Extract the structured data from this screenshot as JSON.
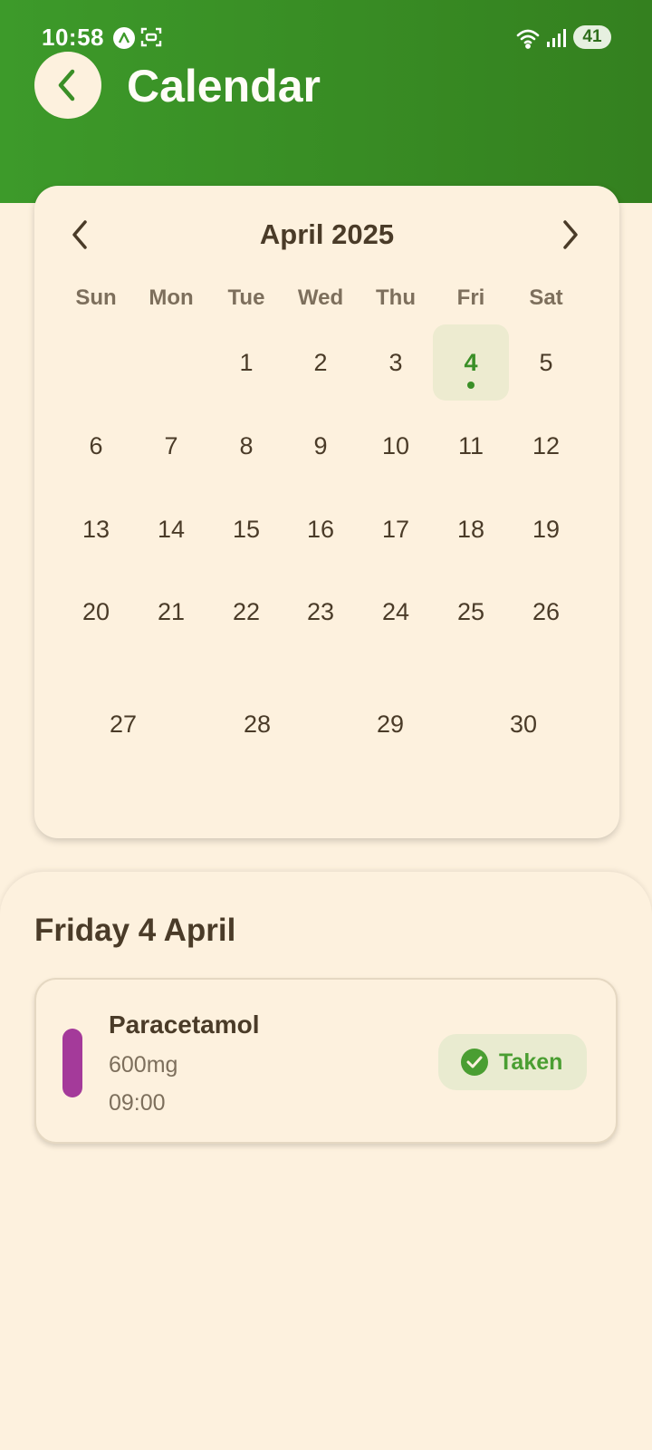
{
  "status_bar": {
    "time": "10:58",
    "battery": "41",
    "icons": [
      "app-a-icon",
      "screen-capture-icon",
      "wifi-icon",
      "signal-icon"
    ]
  },
  "header": {
    "title": "Calendar",
    "back_icon": "chevron-left-icon",
    "background_color": "#3d9a2a"
  },
  "calendar": {
    "month_title": "April 2025",
    "weekdays": [
      "Sun",
      "Mon",
      "Tue",
      "Wed",
      "Thu",
      "Fri",
      "Sat"
    ],
    "days": {
      "d1": "1",
      "d2": "2",
      "d3": "3",
      "d4": "4",
      "d5": "5",
      "d6": "6",
      "d7": "7",
      "d8": "8",
      "d9": "9",
      "d10": "10",
      "d11": "11",
      "d12": "12",
      "d13": "13",
      "d14": "14",
      "d15": "15",
      "d16": "16",
      "d17": "17",
      "d18": "18",
      "d19": "19",
      "d20": "20",
      "d21": "21",
      "d22": "22",
      "d23": "23",
      "d24": "24",
      "d25": "25",
      "d26": "26",
      "d27": "27",
      "d28": "28",
      "d29": "29",
      "d30": "30"
    },
    "selected_day": "4",
    "accent_color": "#3a8f27"
  },
  "day_detail": {
    "heading": "Friday 4 April",
    "medications": [
      {
        "name": "Paracetamol",
        "dose": "600mg",
        "time": "09:00",
        "status": "Taken",
        "color": "#a43a9a"
      }
    ]
  }
}
